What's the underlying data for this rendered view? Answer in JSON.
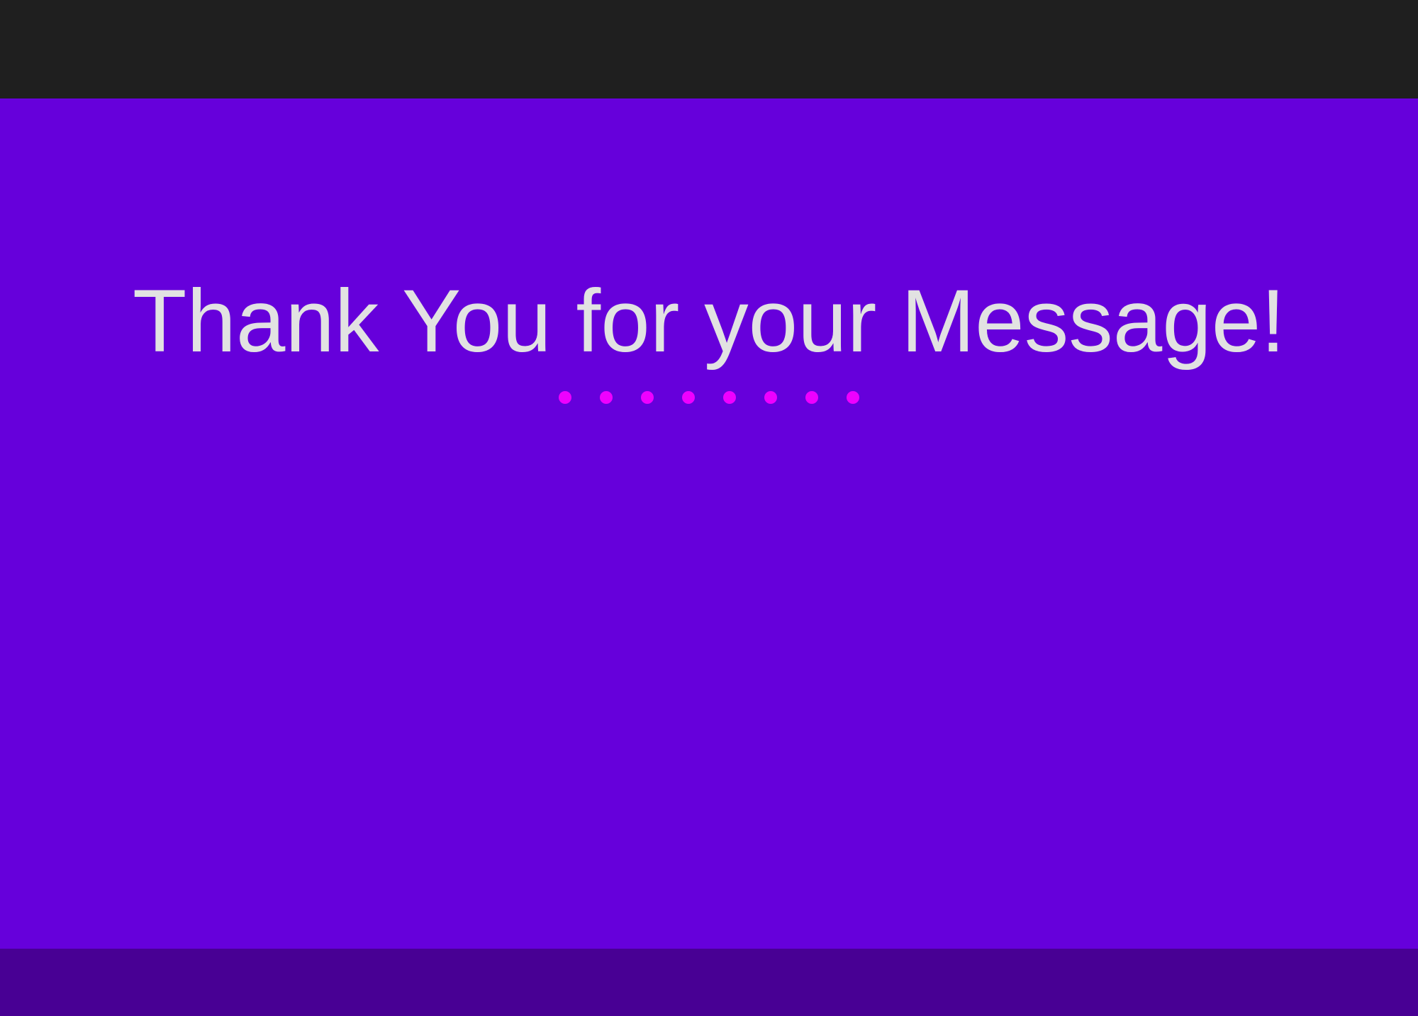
{
  "message": {
    "title": "Thank You for your Message!"
  },
  "loading_indicator": {
    "dot_count": 8,
    "dot_color": "#ee00ff"
  },
  "colors": {
    "top_bar": "#1f1f1f",
    "background": "#6600db",
    "bottom_bar": "#480094",
    "title_text": "#e2e2e2"
  }
}
